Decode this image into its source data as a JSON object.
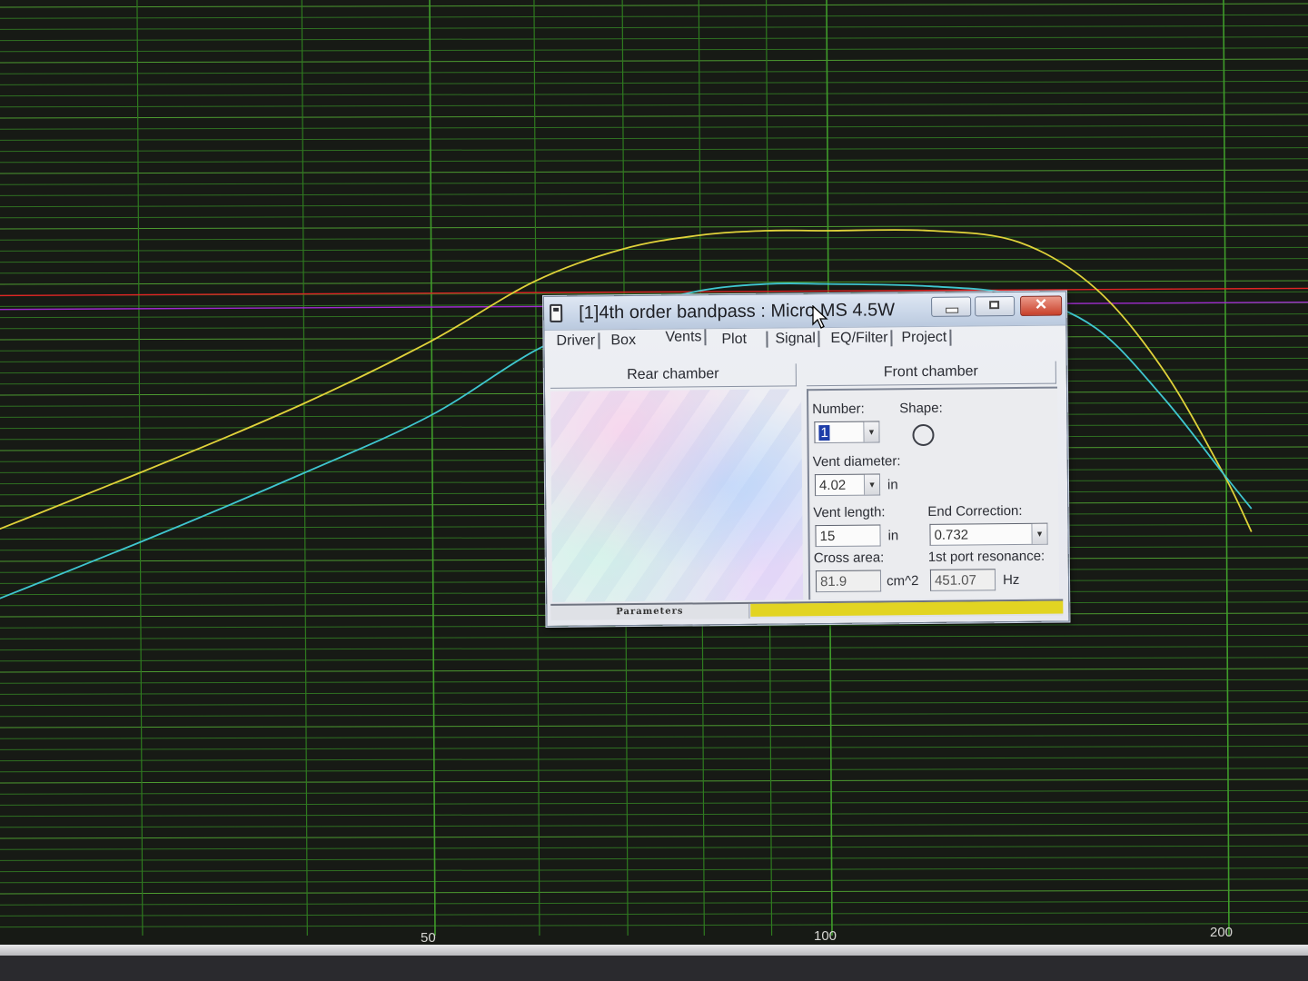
{
  "window": {
    "title": "[1]4th order bandpass : Micro MS 4.5W"
  },
  "tabs": [
    {
      "label": "Driver"
    },
    {
      "label": "Box"
    },
    {
      "label": "Vents"
    },
    {
      "label": "Plot"
    },
    {
      "label": "Signal"
    },
    {
      "label": "EQ/Filter"
    },
    {
      "label": "Project"
    }
  ],
  "chambers": {
    "rear": "Rear chamber",
    "front": "Front chamber"
  },
  "front_chamber": {
    "number_label": "Number:",
    "number_value": "1",
    "shape_label": "Shape:",
    "vent_diameter_label": "Vent diameter:",
    "vent_diameter_value": "4.02",
    "vent_diameter_unit": "in",
    "vent_length_label": "Vent length:",
    "vent_length_value": "15",
    "vent_length_unit": "in",
    "end_correction_label": "End Correction:",
    "end_correction_value": "0.732",
    "cross_area_label": "Cross area:",
    "cross_area_value": "81.9",
    "cross_area_unit": "cm^2",
    "port_resonance_label": "1st port resonance:",
    "port_resonance_value": "451.07",
    "port_resonance_unit": "Hz"
  },
  "status": {
    "label": "Parameters"
  },
  "chart_data": {
    "type": "line",
    "x_scale": "log",
    "grid": true,
    "x_tick_labels": [
      "50",
      "100",
      "200"
    ],
    "series": [
      {
        "color": "#e0d23a",
        "x": [
          20,
          30,
          40,
          50,
          60,
          70,
          80,
          90,
          100,
          120,
          140,
          160,
          180,
          200,
          210
        ],
        "y": [
          -14.5,
          -10.5,
          -7.5,
          -4.8,
          -2.2,
          -0.8,
          -0.2,
          0,
          0,
          0,
          -0.5,
          -2.5,
          -6.0,
          -10.5,
          -13.0
        ]
      },
      {
        "color": "#3fc6cf",
        "x": [
          20,
          30,
          40,
          50,
          60,
          70,
          80,
          90,
          100,
          120,
          140,
          160,
          180,
          200,
          210
        ],
        "y": [
          -17.5,
          -13.5,
          -10.5,
          -8.0,
          -5.2,
          -3.5,
          -2.6,
          -2.3,
          -2.3,
          -2.4,
          -2.8,
          -4.2,
          -7.2,
          -10.5,
          -12.0
        ]
      }
    ],
    "reference_lines": [
      {
        "color": "#e02424",
        "y": -2.8
      },
      {
        "color": "#a02ad0",
        "y": -3.4
      }
    ]
  }
}
